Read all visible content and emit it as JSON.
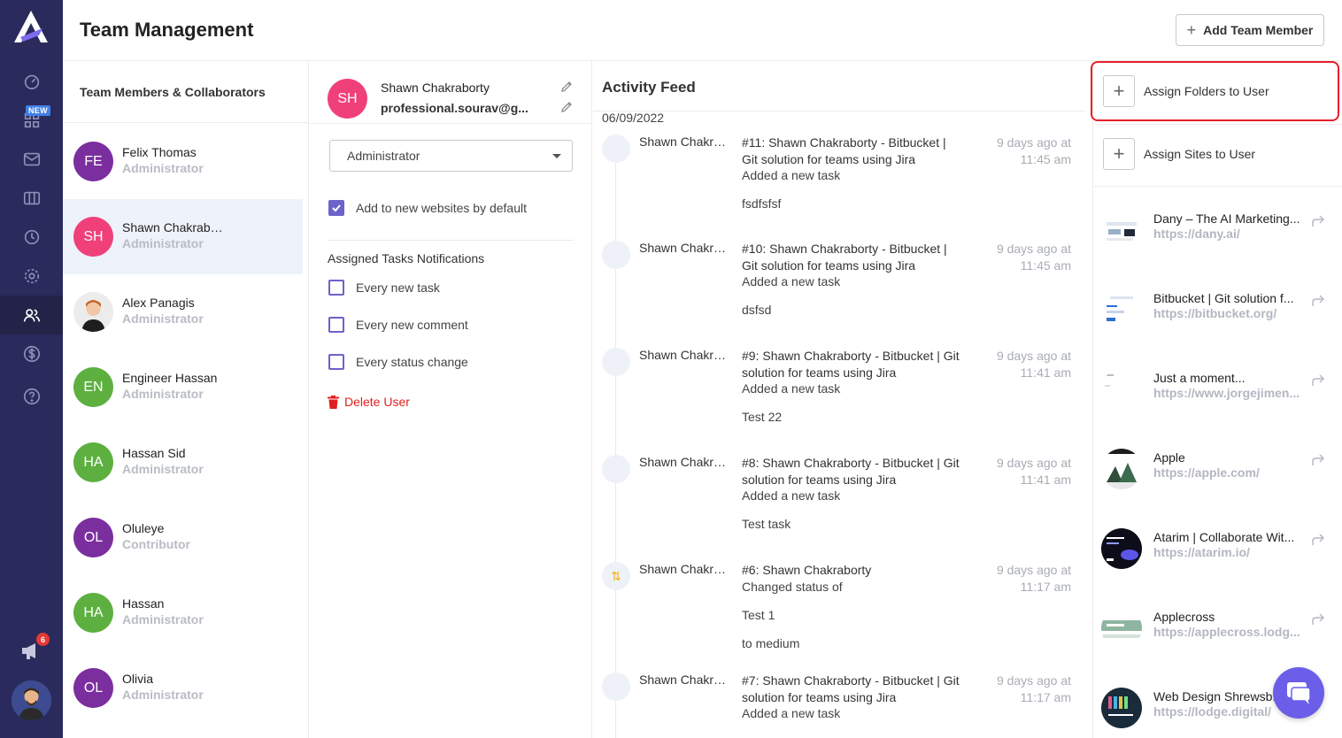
{
  "header": {
    "title": "Team Management",
    "add_member_label": "Add Team Member"
  },
  "nav": {
    "items": [
      "dashboard-icon",
      "apps-icon",
      "mail-icon",
      "columns-icon",
      "clock-icon",
      "settings-icon",
      "users-icon",
      "dollar-icon",
      "help-icon"
    ],
    "active": "users-icon",
    "new_badge": "NEW",
    "notification_count": "6"
  },
  "members": {
    "title": "Team Members & Collaborators",
    "list": [
      {
        "initials": "FE",
        "name": "Felix Thomas",
        "role": "Administrator",
        "color": "#7b2f9e"
      },
      {
        "initials": "SH",
        "name": "Shawn Chakraborty",
        "role": "Administrator",
        "color": "#f0407a"
      },
      {
        "initials": "",
        "name": "Alex Panagis",
        "role": "Administrator",
        "color": "#d8d8d8"
      },
      {
        "initials": "EN",
        "name": "Engineer Hassan",
        "role": "Administrator",
        "color": "#5db040"
      },
      {
        "initials": "HA",
        "name": "Hassan Sid",
        "role": "Administrator",
        "color": "#5db040"
      },
      {
        "initials": "OL",
        "name": "Oluleye",
        "role": "Contributor",
        "color": "#7b2f9e"
      },
      {
        "initials": "HA",
        "name": "Hassan",
        "role": "Administrator",
        "color": "#5db040"
      },
      {
        "initials": "OL",
        "name": "Olivia",
        "role": "Administrator",
        "color": "#7b2f9e"
      }
    ]
  },
  "detail": {
    "initials": "SH",
    "name": "Shawn Chakraborty",
    "email": "professional.sourav@g...",
    "role_selected": "Administrator",
    "add_default_label": "Add to new websites by default",
    "add_default_checked": true,
    "notifications_title": "Assigned Tasks Notifications",
    "notifications": [
      {
        "label": "Every new task",
        "checked": false
      },
      {
        "label": "Every new comment",
        "checked": false
      },
      {
        "label": "Every status change",
        "checked": false
      }
    ],
    "delete_label": "Delete User"
  },
  "feed": {
    "title": "Activity Feed",
    "date": "06/09/2022",
    "entries": [
      {
        "who": "Shawn Chakraborty",
        "task": "#11: Shawn Chakraborty - Bitbucket | Git solution for teams using Jira",
        "action": "Added a new task",
        "notes": [
          "fsdfsfsf"
        ],
        "when": "9 days ago at 11:45 am",
        "icon": ""
      },
      {
        "who": "Shawn Chakraborty",
        "task": "#10: Shawn Chakraborty - Bitbucket | Git solution for teams using Jira",
        "action": "Added a new task",
        "notes": [
          "dsfsd"
        ],
        "when": "9 days ago at 11:45 am",
        "icon": ""
      },
      {
        "who": "Shawn Chakraborty",
        "task": "#9: Shawn Chakraborty - Bitbucket | Git solution for teams using Jira",
        "action": "Added a new task",
        "notes": [
          "Test 22"
        ],
        "when": "9 days ago at 11:41 am",
        "icon": ""
      },
      {
        "who": "Shawn Chakraborty",
        "task": "#8: Shawn Chakraborty - Bitbucket | Git solution for teams using Jira",
        "action": "Added a new task",
        "notes": [
          "Test task"
        ],
        "when": "9 days ago at 11:41 am",
        "icon": ""
      },
      {
        "who": "Shawn Chakraborty",
        "task": "#6: Shawn Chakraborty",
        "action": "Changed status of",
        "notes": [
          "Test 1",
          "to medium"
        ],
        "when": "9 days ago at 11:17 am",
        "icon": "⇅"
      },
      {
        "who": "Shawn Chakraborty",
        "task": "#7: Shawn Chakraborty - Bitbucket | Git solution for teams using Jira",
        "action": "Added a new task",
        "notes": [],
        "when": "9 days ago at 11:17 am",
        "icon": ""
      }
    ]
  },
  "right": {
    "assign_folders_label": "Assign Folders to User",
    "assign_sites_label": "Assign Sites to User",
    "sites": [
      {
        "name": "Dany – The AI Marketing...",
        "url": "https://dany.ai/",
        "thumb": "#ffffff"
      },
      {
        "name": "Bitbucket | Git solution f...",
        "url": "https://bitbucket.org/",
        "thumb": "#ffffff"
      },
      {
        "name": "Just a moment...",
        "url": "https://www.jorgejimen...",
        "thumb": "#ffffff"
      },
      {
        "name": "Apple",
        "url": "https://apple.com/",
        "thumb": "#ffffff"
      },
      {
        "name": "Atarim | Collaborate Wit...",
        "url": "https://atarim.io/",
        "thumb": "#0d0d1a"
      },
      {
        "name": "Applecross",
        "url": "https://applecross.lodg...",
        "thumb": "#ffffff"
      },
      {
        "name": "Web Design Shrewsb...",
        "url": "https://lodge.digital/",
        "thumb": "#1a2b3a"
      }
    ]
  },
  "colors": {
    "nav_bg": "#2b2a5c",
    "accent_purple": "#6b63c9",
    "danger": "#e02020",
    "highlight": "#e5202a",
    "chat": "#6b5ee8"
  }
}
